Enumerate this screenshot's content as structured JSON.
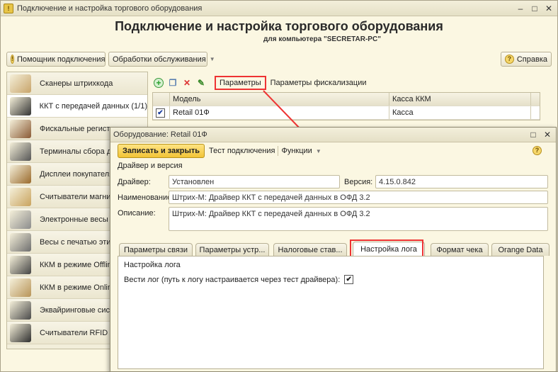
{
  "main": {
    "window_title": "Подключение и настройка торгового оборудования",
    "heading": "Подключение и настройка торгового оборудования",
    "subheading": "для компьютера \"SECRETAR-PC\"",
    "toolbar": {
      "wizard_label": "Помощник подключения",
      "service_label": "Обработки обслуживания",
      "help_label": "Справка"
    },
    "categories": [
      {
        "label": "Сканеры штрихкода",
        "color": "#c8a46a"
      },
      {
        "label": "ККТ с передачей данных (1/1)",
        "color": "#333333"
      },
      {
        "label": "Фискальные регистр",
        "color": "#8a5a34"
      },
      {
        "label": "Терминалы сбора да",
        "color": "#555555"
      },
      {
        "label": "Дисплеи покупателя",
        "color": "#9a6a2c"
      },
      {
        "label": "Считыватели магнит",
        "color": "#c9a35e"
      },
      {
        "label": "Электронные весы",
        "color": "#8c8c8c"
      },
      {
        "label": "Весы с печатью этик",
        "color": "#6e6e6e"
      },
      {
        "label": "ККМ в режиме Offline",
        "color": "#444444"
      },
      {
        "label": "ККМ в режиме Online",
        "color": "#b89458"
      },
      {
        "label": "Эквайринговые систе",
        "color": "#4a4a4a"
      },
      {
        "label": "Считыватели RFID м",
        "color": "#2e2e2e"
      }
    ],
    "grid_toolbar": {
      "params_label": "Параметры",
      "fiscal_params_label": "Параметры фискализации"
    },
    "grid": {
      "headers": [
        "Модель",
        "Касса ККМ"
      ],
      "rows": [
        {
          "model": "Retail 01Ф",
          "register": "Касса",
          "checked": true
        }
      ]
    }
  },
  "dialog": {
    "title": "Оборудование: Retail 01Ф",
    "save_close_label": "Записать и закрыть",
    "test_label": "Тест подключения",
    "functions_label": "Функции",
    "section_label": "Драйвер и версия",
    "driver_label": "Драйвер:",
    "driver_value": "Установлен",
    "version_label": "Версия:",
    "version_value": "4.15.0.842",
    "name_label": "Наименование:",
    "name_value": "Штрих-М: Драйвер ККТ с передачей данных в ОФД 3.2",
    "desc_label": "Описание:",
    "desc_value": "Штрих-М: Драйвер ККТ с передачей данных в ОФД 3.2",
    "tabs": [
      "Параметры связи",
      "Параметры устр...",
      "Налоговые став...",
      "Настройка лога",
      "Формат чека",
      "Orange Data"
    ],
    "log_section_label": "Настройка лога",
    "log_option_label": "Вести лог (путь к логу настраивается через тест драйвера):",
    "log_checked": true
  }
}
